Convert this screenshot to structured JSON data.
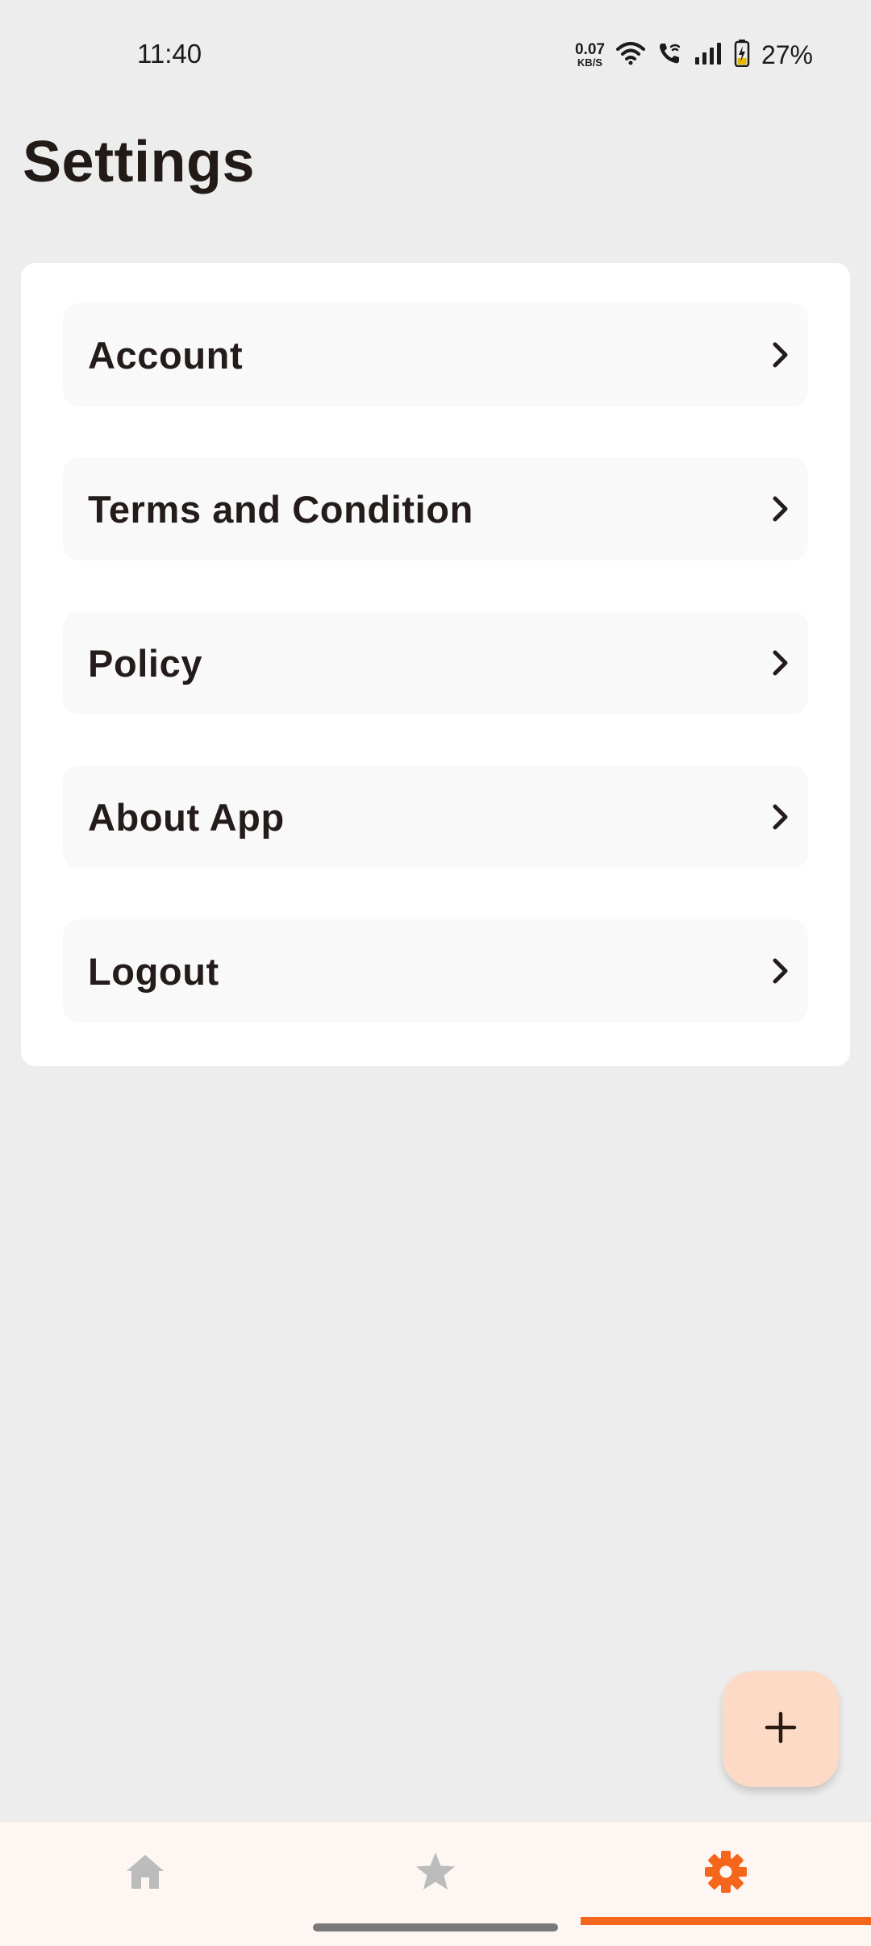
{
  "status_bar": {
    "time": "11:40",
    "net_speed_value": "0.07",
    "net_speed_unit": "KB/S",
    "battery": "27%",
    "icons": [
      "wifi-icon",
      "wifi-call-icon",
      "signal-icon",
      "battery-charging-icon"
    ]
  },
  "page": {
    "title": "Settings"
  },
  "menu": {
    "items": [
      {
        "label": "Account",
        "icon": "chevron-right-icon"
      },
      {
        "label": "Terms and Condition",
        "icon": "chevron-right-icon"
      },
      {
        "label": "Policy",
        "icon": "chevron-right-icon"
      },
      {
        "label": "About App",
        "icon": "chevron-right-icon"
      },
      {
        "label": "Logout",
        "icon": "chevron-right-icon"
      }
    ]
  },
  "fab": {
    "icon": "plus-icon"
  },
  "bottom_nav": {
    "items": [
      {
        "name": "home",
        "icon": "home-icon",
        "active": false
      },
      {
        "name": "favorites",
        "icon": "star-icon",
        "active": false
      },
      {
        "name": "settings",
        "icon": "gear-icon",
        "active": true
      }
    ]
  },
  "colors": {
    "background": "#ededed",
    "card": "#ffffff",
    "menu_item_bg": "#f9f9f9",
    "text": "#231c1a",
    "accent": "#f4661b",
    "fab_bg": "#fddac6",
    "nav_bg": "#fdf6f2",
    "nav_inactive": "#bcbcbc"
  }
}
